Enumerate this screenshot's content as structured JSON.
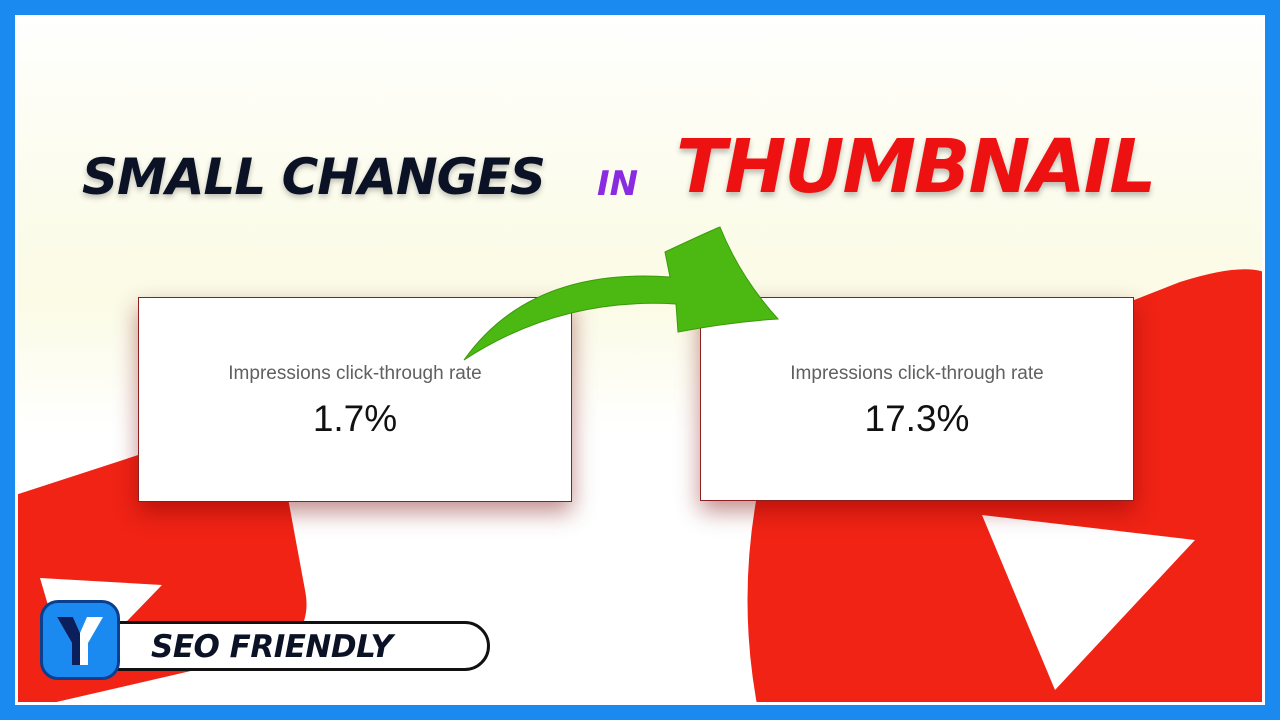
{
  "headline": {
    "part1": "SMALL CHANGES",
    "part2": "IN",
    "part3": "THUMBNAIL"
  },
  "cards": {
    "before": {
      "label": "Impressions click-through rate",
      "value": "1.7%"
    },
    "after": {
      "label": "Impressions click-through rate",
      "value": "17.3%"
    }
  },
  "badge": {
    "text": "SEO FRIENDLY",
    "logo_icon": "y-logo-icon"
  },
  "colors": {
    "frame_border": "#1b8af0",
    "accent_red": "#ee1111",
    "accent_purple": "#8a2be2",
    "arrow_green": "#4cb812",
    "text_dark": "#0c1226"
  },
  "icons": [
    "play-triangle-icon",
    "curved-arrow-icon",
    "y-logo-icon"
  ]
}
